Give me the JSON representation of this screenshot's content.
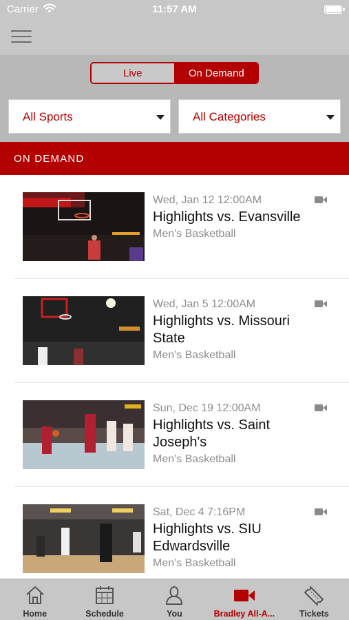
{
  "status_bar": {
    "carrier": "Carrier",
    "time": "11:57 AM"
  },
  "toggle": {
    "live_label": "Live",
    "on_demand_label": "On Demand",
    "selected": "On Demand"
  },
  "filters": {
    "sports": "All Sports",
    "categories": "All Categories"
  },
  "section_title": "ON DEMAND",
  "videos": [
    {
      "date": "Wed, Jan 12 12:00AM",
      "title": "Highlights vs. Evansville",
      "sport": "Men's Basketball"
    },
    {
      "date": "Wed, Jan 5 12:00AM",
      "title": "Highlights vs. Missouri State",
      "sport": "Men's Basketball"
    },
    {
      "date": "Sun, Dec 19 12:00AM",
      "title": "Highlights vs. Saint Joseph's",
      "sport": "Men's Basketball"
    },
    {
      "date": "Sat, Dec 4 7:16PM",
      "title": "Highlights vs. SIU Edwardsville",
      "sport": "Men's Basketball"
    }
  ],
  "tabs": [
    {
      "label": "Home",
      "icon": "home-icon"
    },
    {
      "label": "Schedule",
      "icon": "calendar-icon"
    },
    {
      "label": "You",
      "icon": "person-icon"
    },
    {
      "label": "Bradley All-A...",
      "icon": "video-camera-icon",
      "active": true
    },
    {
      "label": "Tickets",
      "icon": "ticket-icon"
    }
  ],
  "colors": {
    "brand_red": "#b30000",
    "chrome_gray": "#c7c7c7",
    "control_gray": "#b8b8b8"
  }
}
